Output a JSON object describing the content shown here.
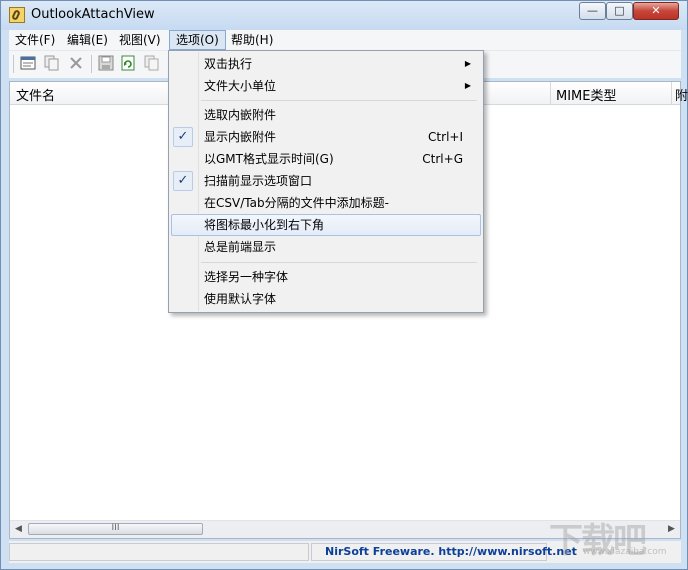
{
  "window": {
    "title": "OutlookAttachView",
    "controls": {
      "minimize": "—",
      "maximize": "□",
      "close": "✕"
    }
  },
  "menubar": {
    "items": [
      {
        "label": "文件(F)"
      },
      {
        "label": "编辑(E)"
      },
      {
        "label": "视图(V)"
      },
      {
        "label": "选项(O)",
        "active": true
      },
      {
        "label": "帮助(H)"
      }
    ]
  },
  "toolbar": {
    "icons": [
      "properties-icon",
      "copy-icon",
      "delete-icon",
      "save-icon",
      "refresh-icon",
      "copy-selected-icon"
    ]
  },
  "list": {
    "columns": [
      {
        "label": "文件名"
      },
      {
        "label": "MIME类型"
      },
      {
        "label": "附"
      }
    ],
    "scroll_thumb_label": "III"
  },
  "options_menu": {
    "items": [
      {
        "label": "双击执行",
        "has_submenu": true
      },
      {
        "label": "文件大小单位",
        "has_submenu": true
      },
      {
        "label": "选取内嵌附件"
      },
      {
        "label": "显示内嵌附件",
        "shortcut": "Ctrl+I",
        "checked": true
      },
      {
        "label": "以GMT格式显示时间(G)",
        "shortcut": "Ctrl+G"
      },
      {
        "label": "扫描前显示选项窗口",
        "checked": true
      },
      {
        "label": "在CSV/Tab分隔的文件中添加标题-"
      },
      {
        "label": "将图标最小化到右下角",
        "highlighted": true
      },
      {
        "label": "总是前端显示"
      },
      {
        "label": "选择另一种字体"
      },
      {
        "label": "使用默认字体"
      }
    ],
    "submenu_arrow": "▶",
    "check_mark": "✓"
  },
  "statusbar": {
    "link_text": "NirSoft Freeware.  http://www.nirsoft.net"
  },
  "watermark": {
    "text": "下载吧",
    "sub": "www.xiazaiba.com"
  },
  "colors": {
    "link": "#0c3f99",
    "menu_highlight_border": "#a9c2e3",
    "check": "#1f3d7a"
  }
}
